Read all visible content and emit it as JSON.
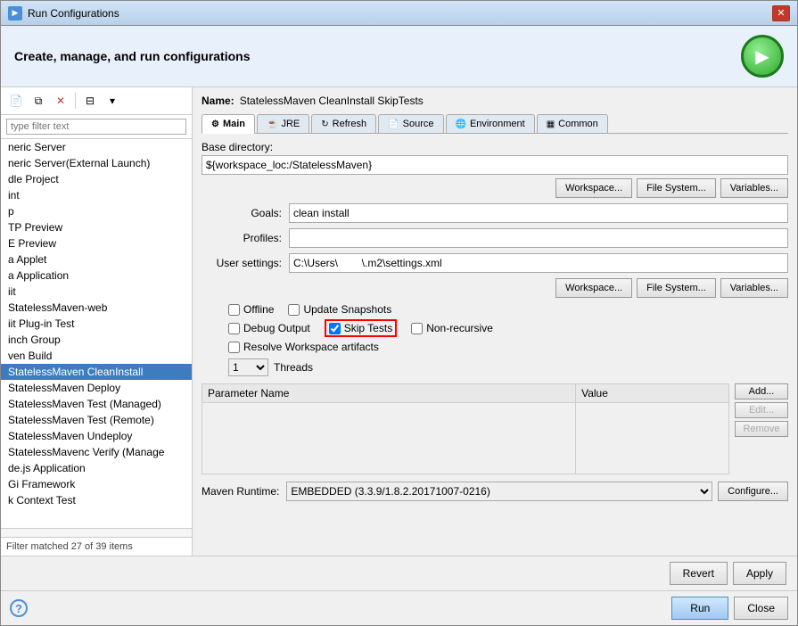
{
  "window": {
    "title": "Run Configurations",
    "header_title": "Create, manage, and run configurations"
  },
  "toolbar": {
    "new_label": "New",
    "duplicate_label": "Duplicate",
    "delete_label": "Delete",
    "collapse_label": "Collapse",
    "expand_label": "Expand"
  },
  "sidebar": {
    "filter_placeholder": "type filter text",
    "items": [
      {
        "label": "neric Server",
        "selected": false
      },
      {
        "label": "neric Server(External Launch)",
        "selected": false
      },
      {
        "label": "dle Project",
        "selected": false
      },
      {
        "label": "int",
        "selected": false
      },
      {
        "label": "p",
        "selected": false
      },
      {
        "label": "TP Preview",
        "selected": false
      },
      {
        "label": "E Preview",
        "selected": false
      },
      {
        "label": "a Applet",
        "selected": false
      },
      {
        "label": "a Application",
        "selected": false
      },
      {
        "label": "iit",
        "selected": false
      },
      {
        "label": "StatelessMaven-web",
        "selected": false
      },
      {
        "label": "iit Plug-in Test",
        "selected": false
      },
      {
        "label": "inch Group",
        "selected": false
      },
      {
        "label": "ven Build",
        "selected": false
      },
      {
        "label": "StatelessMaven CleanInstall",
        "selected": true
      },
      {
        "label": "StatelessMaven Deploy",
        "selected": false
      },
      {
        "label": "StatelessMaven Test (Managed)",
        "selected": false
      },
      {
        "label": "StatelessMaven Test (Remote)",
        "selected": false
      },
      {
        "label": "StatelessMaven Undeploy",
        "selected": false
      },
      {
        "label": "StatelessMavenc Verify (Manage",
        "selected": false
      },
      {
        "label": "de.js Application",
        "selected": false
      },
      {
        "label": "Gi Framework",
        "selected": false
      },
      {
        "label": "k Context Test",
        "selected": false
      }
    ],
    "footer": "Filter matched 27 of 39 items"
  },
  "config": {
    "name_label": "Name:",
    "name_value": "StatelessMaven CleanInstall SkipTests",
    "tabs": [
      {
        "id": "main",
        "label": "Main",
        "icon": "⚙",
        "active": true
      },
      {
        "id": "jre",
        "label": "JRE",
        "icon": "☕",
        "active": false
      },
      {
        "id": "refresh",
        "label": "Refresh",
        "icon": "↻",
        "active": false
      },
      {
        "id": "source",
        "label": "Source",
        "icon": "📄",
        "active": false
      },
      {
        "id": "environment",
        "label": "Environment",
        "icon": "🌐",
        "active": false
      },
      {
        "id": "common",
        "label": "Common",
        "icon": "▦",
        "active": false
      }
    ],
    "base_directory_label": "Base directory:",
    "base_directory_value": "${workspace_loc:/StatelessMaven}",
    "btn_workspace": "Workspace...",
    "btn_filesystem": "File System...",
    "btn_variables": "Variables...",
    "goals_label": "Goals:",
    "goals_value": "clean install",
    "profiles_label": "Profiles:",
    "profiles_value": "",
    "user_settings_label": "User settings:",
    "user_settings_value": "C:\\Users\\        \\.m2\\settings.xml",
    "btn_workspace2": "Workspace...",
    "btn_filesystem2": "File System...",
    "btn_variables2": "Variables...",
    "checkboxes": {
      "offline_label": "Offline",
      "offline_checked": false,
      "update_snapshots_label": "Update Snapshots",
      "update_snapshots_checked": false,
      "debug_output_label": "Debug Output",
      "debug_output_checked": false,
      "skip_tests_label": "Skip Tests",
      "skip_tests_checked": true,
      "non_recursive_label": "Non-recursive",
      "non_recursive_checked": false,
      "resolve_workspace_label": "Resolve Workspace artifacts",
      "resolve_workspace_checked": false
    },
    "threads_label": "Threads",
    "threads_value": "1",
    "table": {
      "col_param": "Parameter Name",
      "col_value": "Value",
      "rows": []
    },
    "btn_add": "Add...",
    "btn_edit": "Edit...",
    "btn_remove": "Remove",
    "runtime_label": "Maven Runtime:",
    "runtime_value": "EMBEDDED (3.3.9/1.8.2.20171007-0216)",
    "btn_configure": "Configure...",
    "btn_revert": "Revert",
    "btn_apply": "Apply",
    "btn_run": "Run",
    "btn_close": "Close"
  }
}
